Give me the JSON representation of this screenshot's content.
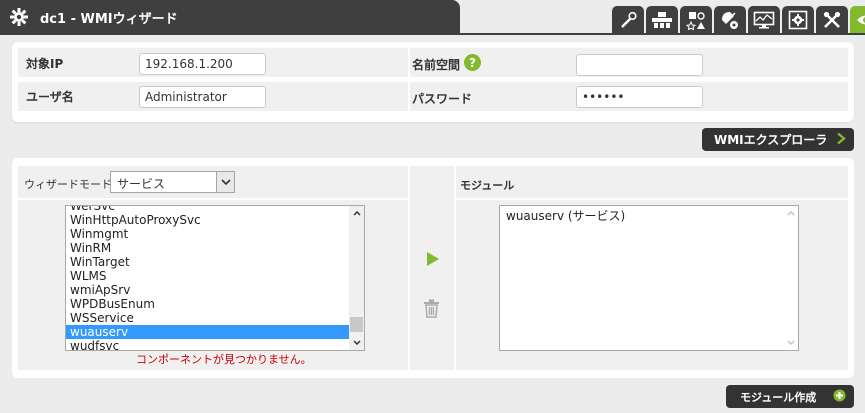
{
  "header": {
    "title": "dc1 - WMIウィザード",
    "title_icon": "gear-icon",
    "toolbar_icons": [
      "wand-icon",
      "network-icon",
      "shapes-icon",
      "satellite-gear-icon",
      "monitor-icon",
      "gear-box-icon",
      "tools-icon",
      "eye-icon"
    ]
  },
  "connection": {
    "target_ip_label": "対象IP",
    "target_ip_value": "192.168.1.200",
    "namespace_label": "名前空間",
    "namespace_value": "",
    "username_label": "ユーザ名",
    "username_value": "Administrator",
    "password_label": "パスワード",
    "password_value": "••••••"
  },
  "explorer_button": {
    "label": "WMIエクスプローラ"
  },
  "wizard": {
    "mode_label": "ウィザードモード：",
    "mode_value": "サービス",
    "module_label": "モジュール",
    "services": [
      "WerSvc",
      "WinHttpAutoProxySvc",
      "Winmgmt",
      "WinRM",
      "WinTarget",
      "WLMS",
      "wmiApSrv",
      "WPDBusEnum",
      "WSService",
      "wuauserv",
      "wudfsvc"
    ],
    "selected_service": "wuauserv",
    "modules": [
      "wuauserv (サービス)"
    ],
    "error_message": "コンポーネントが見つかりません。"
  },
  "create_button": {
    "label": "モジュール作成"
  },
  "colors": {
    "accent": "#82b92e",
    "dark": "#3f3f3f",
    "selection": "#3399ff",
    "error": "#cc0000"
  }
}
